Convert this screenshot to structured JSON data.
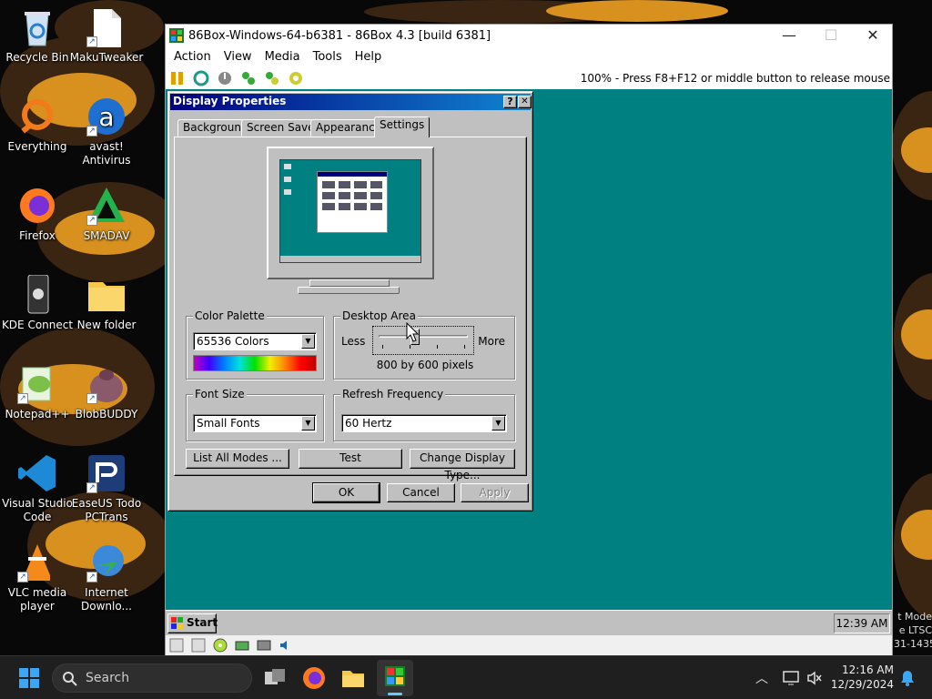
{
  "desktop_icons": [
    {
      "label": "Recycle Bin",
      "icon": "recycle-bin-icon"
    },
    {
      "label": "MakuTweaker",
      "icon": "file-icon"
    },
    {
      "label": "Everything",
      "icon": "everything-icon"
    },
    {
      "label": "avast! Antivirus",
      "icon": "avast-icon"
    },
    {
      "label": "Firefox",
      "icon": "firefox-icon"
    },
    {
      "label": "SMADAV",
      "icon": "smadav-icon"
    },
    {
      "label": "KDE Connect",
      "icon": "kde-connect-icon"
    },
    {
      "label": "New folder",
      "icon": "folder-icon"
    },
    {
      "label": "Notepad++",
      "icon": "notepad-plus-icon"
    },
    {
      "label": "BlobBUDDY",
      "icon": "blobbuddy-icon"
    },
    {
      "label": "Visual Studio Code",
      "icon": "vscode-icon"
    },
    {
      "label": "EaseUS Todo PCTrans",
      "icon": "easeus-icon"
    },
    {
      "label": "VLC media player",
      "icon": "vlc-icon"
    },
    {
      "label": "Internet Downlo...",
      "icon": "idm-icon"
    }
  ],
  "host_window": {
    "title": "86Box-Windows-64-b6381 - 86Box 4.3 [build 6381]",
    "menu": [
      "Action",
      "View",
      "Media",
      "Tools",
      "Help"
    ],
    "status": "100% - Press F8+F12 or middle button to release mouse"
  },
  "dialog": {
    "title": "Display Properties",
    "help": "?",
    "close": "✕",
    "tabs": [
      "Background",
      "Screen Saver",
      "Appearance",
      "Settings"
    ],
    "color_palette": {
      "label": "Color Palette",
      "value": "65536 Colors"
    },
    "desktop_area": {
      "label": "Desktop Area",
      "less": "Less",
      "more": "More",
      "value": "800 by 600 pixels",
      "slider_position": 0.4
    },
    "font_size": {
      "label": "Font Size",
      "value": "Small Fonts"
    },
    "refresh": {
      "label": "Refresh Frequency",
      "value": "60 Hertz"
    },
    "buttons": {
      "list_modes": "List All Modes ...",
      "test": "Test",
      "change_type": "Change Display Type..."
    },
    "ok": "OK",
    "cancel": "Cancel",
    "apply": "Apply"
  },
  "guest_taskbar": {
    "start": "Start",
    "clock": "12:39 AM"
  },
  "watermark": [
    "t Mode",
    "e LTSC",
    "31-1435"
  ],
  "win_taskbar": {
    "search": "Search",
    "time": "12:16 AM",
    "date": "12/29/2024"
  }
}
